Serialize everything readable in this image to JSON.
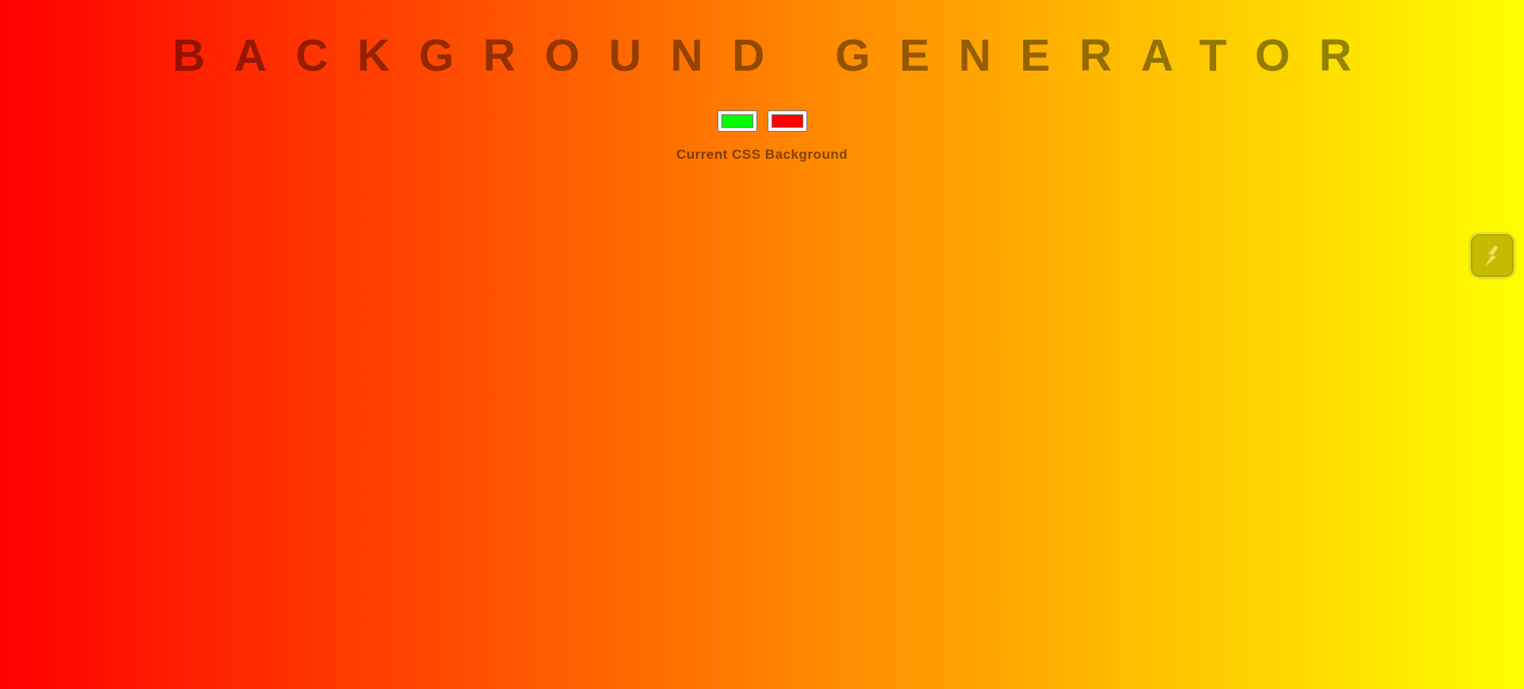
{
  "header": {
    "title": "BACKGROUND GENERATOR"
  },
  "pickers": {
    "color1": "#00ff00",
    "color2": "#ff0000"
  },
  "output": {
    "label": "Current CSS Background"
  },
  "background": {
    "gradient_start": "#ff0000",
    "gradient_end": "#ffff00"
  },
  "side_widget": {
    "icon": "lightning-bolt-icon"
  }
}
